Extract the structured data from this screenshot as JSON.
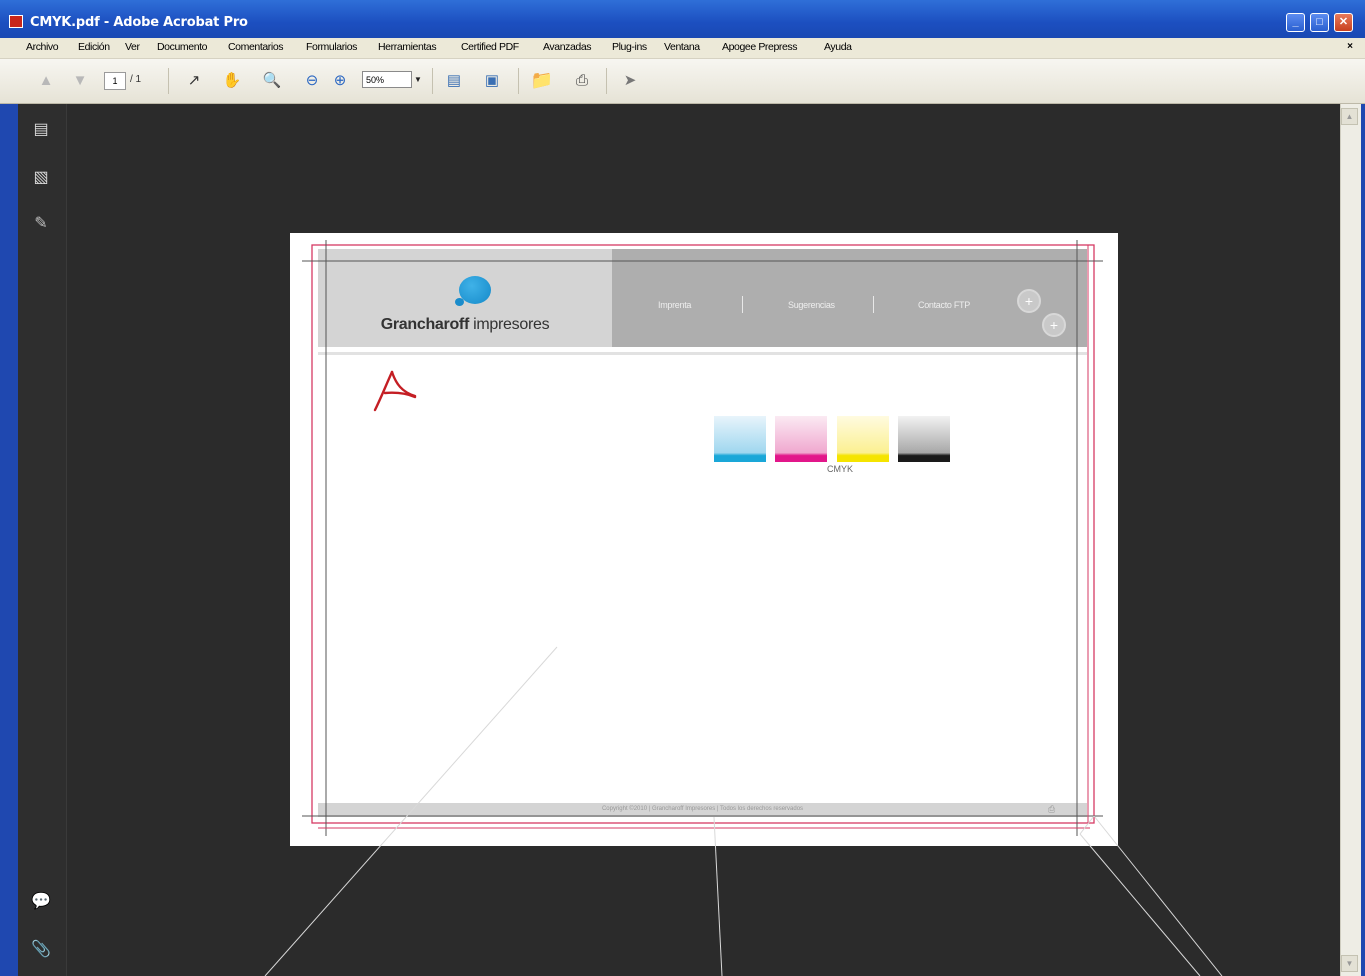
{
  "window": {
    "title": "CMYK.pdf - Adobe Acrobat Pro",
    "controls": {
      "minimize": "_",
      "maximize": "□",
      "close": "✕"
    }
  },
  "menubar": {
    "items": [
      "Archivo",
      "Edición",
      "Ver",
      "Documento",
      "Comentarios",
      "Formularios",
      "Herramientas",
      "Certified PDF",
      "Avanzadas",
      "Plug-ins",
      "Ventana",
      "Apogee Prepress",
      "Ayuda"
    ],
    "close_glyph": "×"
  },
  "toolbar": {
    "page_current": "1",
    "page_total": "/ 1",
    "zoom": "50%"
  },
  "sidebar": {
    "icons": [
      "pages-icon",
      "bookmarks-icon",
      "signatures-icon",
      "comments-icon",
      "attachments-icon"
    ]
  },
  "document": {
    "brand_bold": "Grancharoff",
    "brand_rest": " impresores",
    "nav": [
      "Imprenta",
      "Sugerencias",
      "Contacto FTP"
    ],
    "swatch_label": "CMYK",
    "footer": "Copyright ©2010  |  Grancharoff Impresores  |  Todos los derechos reservados",
    "colors": {
      "cyan": "#1aa7d8",
      "magenta": "#e2168a",
      "yellow": "#f5e400",
      "black": "#1a1a1a"
    }
  }
}
